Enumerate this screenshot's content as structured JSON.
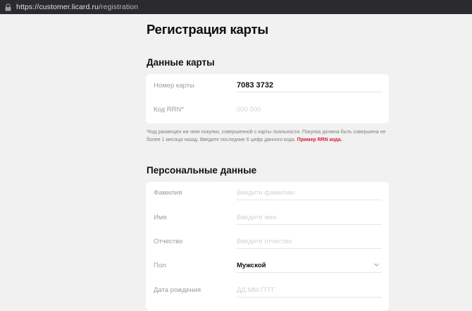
{
  "browser": {
    "url_host": "https://customer.licard.ru",
    "url_path": "/registration"
  },
  "page": {
    "title": "Регистрация карты"
  },
  "card_section": {
    "title": "Данные карты",
    "card_number": {
      "label": "Номер карты",
      "value": "7083 3732"
    },
    "rrn": {
      "label": "Код RRN*",
      "placeholder": "000 000"
    },
    "note": "*Код размещен на чеке покупки, совершенной с карты лояльности. Покупка должна быть совершена не более 1 месяца назад. Введите последние 6 цифр данного кода.",
    "note_link": "Пример RRN кода."
  },
  "personal_section": {
    "title": "Персональные данные",
    "fields": [
      {
        "label": "Фамилия",
        "placeholder": "Введите фамилию"
      },
      {
        "label": "Имя",
        "placeholder": "Введите имя"
      },
      {
        "label": "Отчество",
        "placeholder": "Введите отчество"
      },
      {
        "label": "Пол",
        "value": "Мужской"
      },
      {
        "label": "Дата рождения",
        "placeholder": "ДД.ММ.ГГГГ"
      }
    ]
  },
  "icons": {
    "lock": "lock-icon",
    "chevron": "chevron-down-icon"
  }
}
